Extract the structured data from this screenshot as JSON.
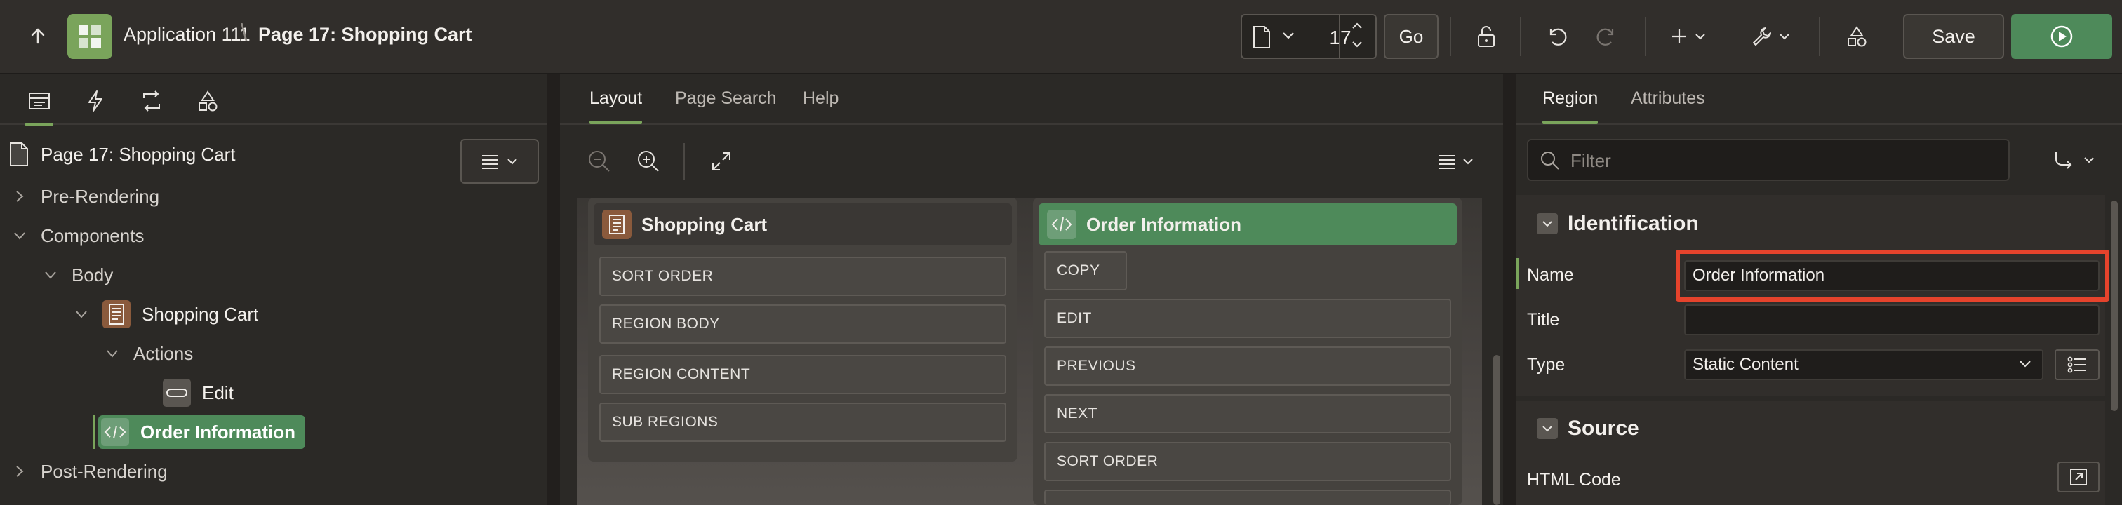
{
  "header": {
    "app_name": "Application 111",
    "separator": "\\",
    "page_title": "Page 17: Shopping Cart",
    "page_number": "17",
    "go_label": "Go",
    "save_label": "Save"
  },
  "left": {
    "tabs": [
      "rendering-tree-icon",
      "dynamic-actions-icon",
      "processing-icon",
      "shared-components-icon"
    ],
    "root_label": "Page 17: Shopping Cart",
    "tree": [
      {
        "label": "Pre-Rendering"
      },
      {
        "label": "Components"
      },
      {
        "label": "Body"
      },
      {
        "label": "Shopping Cart"
      },
      {
        "label": "Actions"
      },
      {
        "label": "Edit"
      },
      {
        "label": "Order Information"
      },
      {
        "label": "Post-Rendering"
      }
    ]
  },
  "center": {
    "tabs": [
      "Layout",
      "Page Search",
      "Help"
    ],
    "regions": [
      {
        "title": "Shopping Cart",
        "slots": [
          "SORT ORDER",
          "REGION BODY",
          "REGION CONTENT",
          "SUB REGIONS"
        ]
      },
      {
        "title": "Order Information",
        "slots": [
          "COPY",
          "EDIT",
          "PREVIOUS",
          "NEXT",
          "SORT ORDER"
        ]
      }
    ]
  },
  "right": {
    "tabs": [
      "Region",
      "Attributes"
    ],
    "filter_placeholder": "Filter",
    "identification": {
      "heading": "Identification",
      "name_label": "Name",
      "name_value": "Order Information",
      "title_label": "Title",
      "title_value": "",
      "type_label": "Type",
      "type_value": "Static Content"
    },
    "source": {
      "heading": "Source",
      "html_code_label": "HTML Code"
    }
  },
  "colors": {
    "accent_green": "#4e8a5a",
    "app_icon_green": "#7aa45b",
    "highlight_red": "#e5432c",
    "region_brown": "#8a5a3c"
  }
}
